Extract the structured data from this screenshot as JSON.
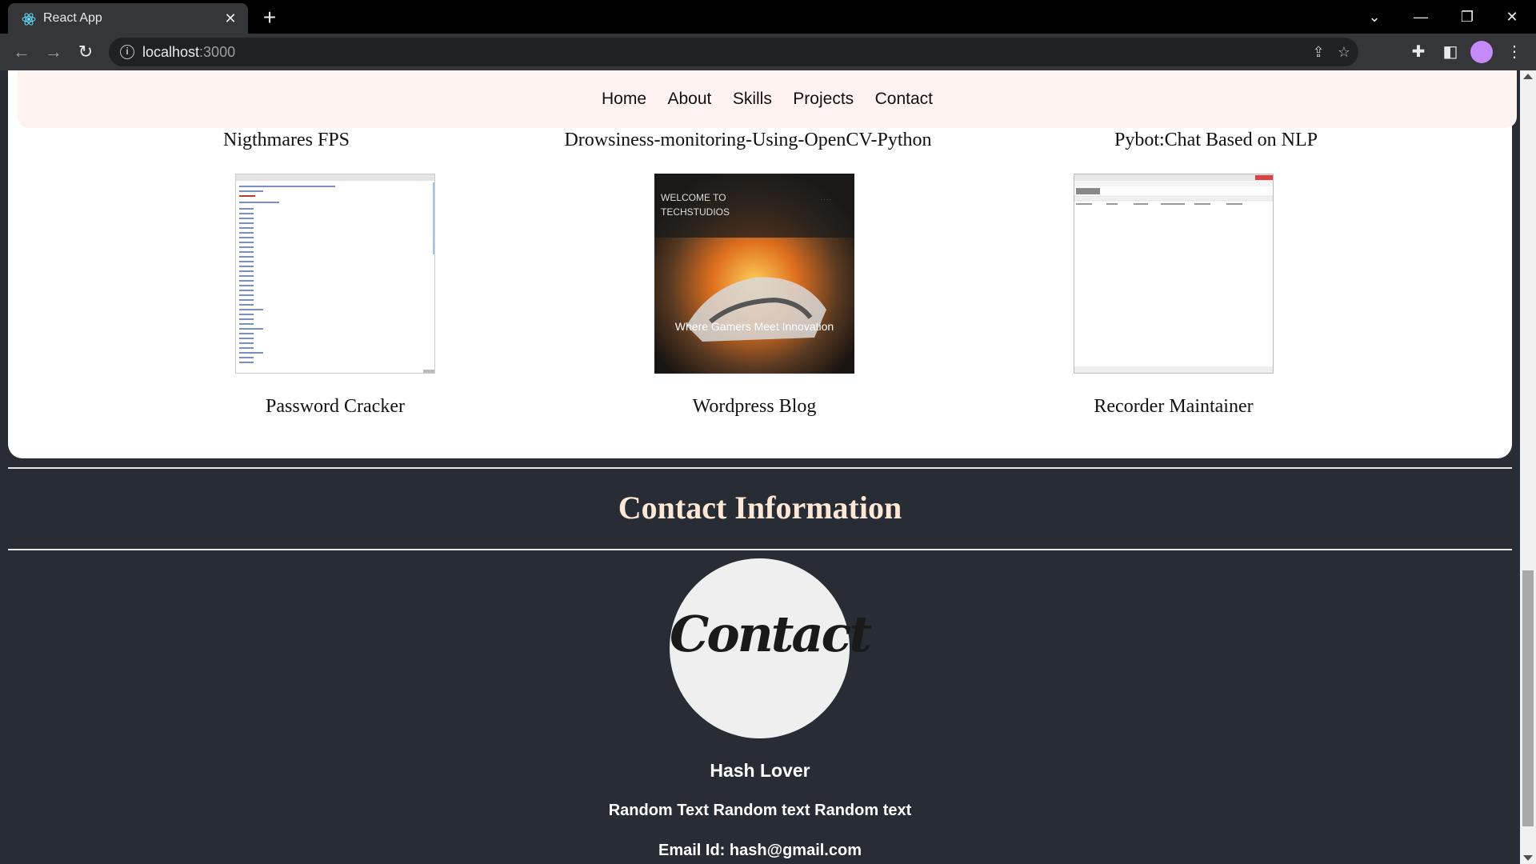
{
  "browser": {
    "tab_title": "React App",
    "url_host": "localhost",
    "url_port": ":3000"
  },
  "nav": {
    "items": [
      "Home",
      "About",
      "Skills",
      "Projects",
      "Contact"
    ]
  },
  "projects": {
    "row1": [
      "Nigthmares FPS",
      "Drowsiness-monitoring-Using-OpenCV-Python",
      "Pybot:Chat Based on NLP"
    ],
    "row2": [
      "Password Cracker",
      "Wordpress Blog",
      "Recorder Maintainer"
    ],
    "thumb_texts": {
      "wordpress_line1": "WELCOME TO",
      "wordpress_line2": "TECHSTUDIOS",
      "wordpress_tagline": "Where Gamers Meet Innovation"
    }
  },
  "contact": {
    "heading": "Contact Information",
    "logo_text": "Contact",
    "name": "Hash Lover",
    "description": "Random Text Random text Random text",
    "email": "Email Id: hash@gmail.com"
  },
  "colors": {
    "page_bg": "#282c34",
    "nav_bg": "#fff3f1",
    "heading": "#ffe9d6"
  }
}
